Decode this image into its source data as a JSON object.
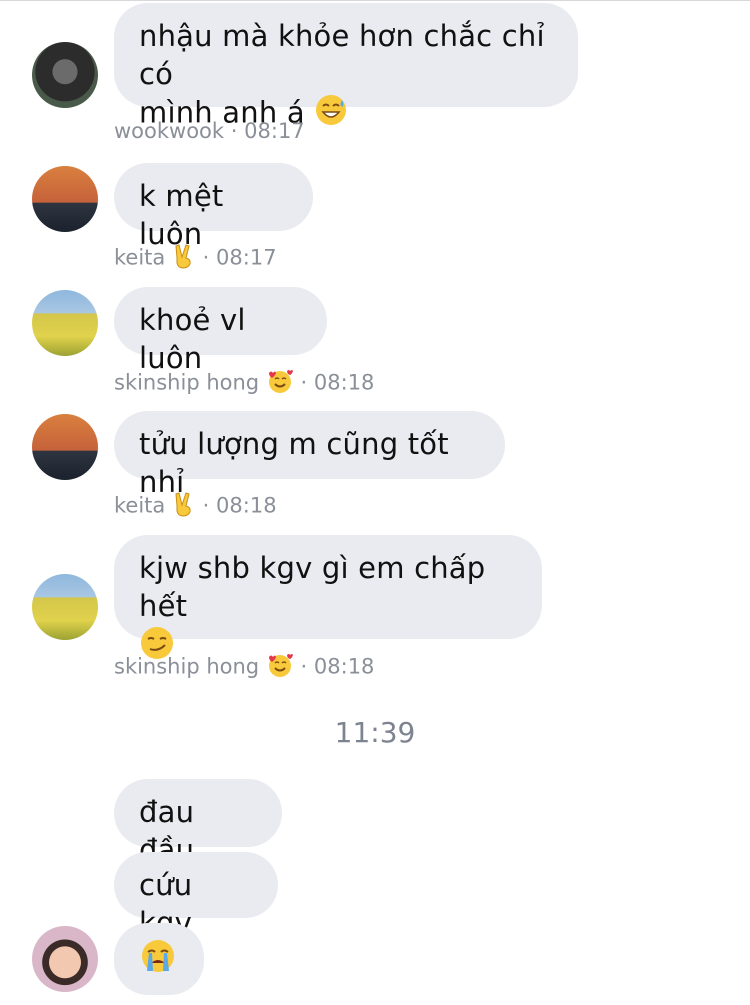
{
  "messages": [
    {
      "text_line1": "nhậu mà khỏe hơn chắc chỉ có",
      "text_line2": "mình anh á",
      "emoji": "sweat-smile",
      "sender": "wookwook",
      "time": "08:17"
    },
    {
      "text": "k mệt luôn",
      "sender": "keita",
      "sender_emoji": "victory-hand",
      "time": "08:17"
    },
    {
      "text": "khoẻ vl luôn",
      "sender": "skinship hong",
      "sender_emoji": "smiling-hearts",
      "time": "08:18"
    },
    {
      "text": "tửu lượng m cũng tốt nhỉ",
      "sender": "keita",
      "sender_emoji": "victory-hand",
      "time": "08:18"
    },
    {
      "text_line1": "kjw shb kgv gì em chấp hết",
      "emoji": "smirk",
      "sender": "skinship hong",
      "sender_emoji": "smiling-hearts",
      "time": "08:18"
    }
  ],
  "time_separator": "11:39",
  "later_messages": [
    {
      "text": "đau đầu"
    },
    {
      "text": "cứu kgv"
    },
    {
      "emoji": "loudly-crying"
    }
  ],
  "meta_separator": "·"
}
